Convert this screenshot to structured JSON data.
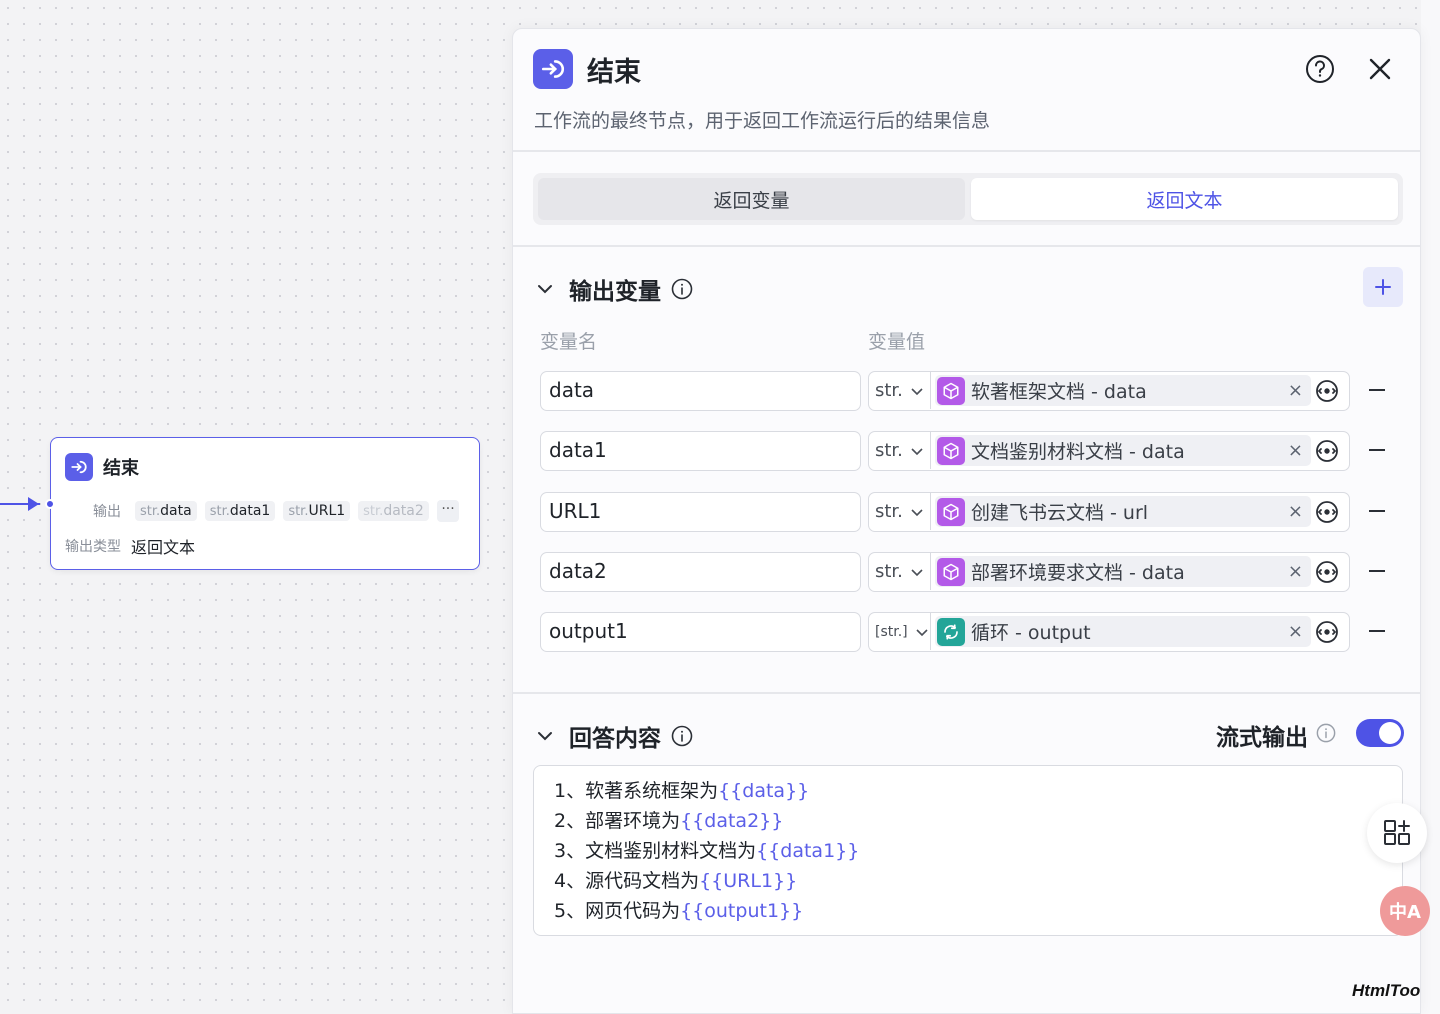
{
  "canvas": {
    "node": {
      "title": "结束",
      "output_label": "输出",
      "output_tags": [
        {
          "type": "str.",
          "name": "data"
        },
        {
          "type": "str.",
          "name": "data1"
        },
        {
          "type": "str.",
          "name": "URL1"
        },
        {
          "type": "str.",
          "name": "data2"
        }
      ],
      "more_label": "···",
      "output_type_label": "输出类型",
      "output_type_value": "返回文本"
    }
  },
  "panel": {
    "title": "结束",
    "description": "工作流的最终节点，用于返回工作流运行后的结果信息",
    "tabs": [
      {
        "label": "返回变量",
        "active": false
      },
      {
        "label": "返回文本",
        "active": true
      }
    ],
    "output_section": {
      "title": "输出变量",
      "col_name": "变量名",
      "col_value": "变量值",
      "rows": [
        {
          "name": "data",
          "type": "str.",
          "ref_label": "软著框架文档 - data",
          "icon": "cube-icon",
          "icon_color": "#b35ae8"
        },
        {
          "name": "data1",
          "type": "str.",
          "ref_label": "文档鉴别材料文档 - data",
          "icon": "cube-icon",
          "icon_color": "#b35ae8"
        },
        {
          "name": "URL1",
          "type": "str.",
          "ref_label": "创建飞书云文档 - url",
          "icon": "cube-icon",
          "icon_color": "#b35ae8"
        },
        {
          "name": "data2",
          "type": "str.",
          "ref_label": "部署环境要求文档 - data",
          "icon": "cube-icon",
          "icon_color": "#b35ae8"
        },
        {
          "name": "output1",
          "type": "[str.]",
          "ref_label": "循环 - output",
          "icon": "loop-icon",
          "icon_color": "#23a598"
        }
      ]
    },
    "answer_section": {
      "title": "回答内容",
      "stream_label": "流式输出",
      "stream_enabled": true,
      "lines": [
        {
          "prefix": "1、软著系统框架为",
          "var": "{{data}}"
        },
        {
          "prefix": "2、部署环境为",
          "var": "{{data2}}"
        },
        {
          "prefix": "3、文档鉴别材料文档为",
          "var": "{{data1}}"
        },
        {
          "prefix": "4、源代码文档为",
          "var": "{{URL1}}"
        },
        {
          "prefix": "5、网页代码为",
          "var": "{{output1}}"
        }
      ]
    }
  },
  "floating": {
    "translate_label": "中A"
  },
  "watermark": "HtmlToo",
  "colors": {
    "accent": "#4e53e6",
    "node_icon": "#5b5fe8",
    "plugin_icon": "#b35ae8",
    "loop_icon": "#23a598"
  }
}
